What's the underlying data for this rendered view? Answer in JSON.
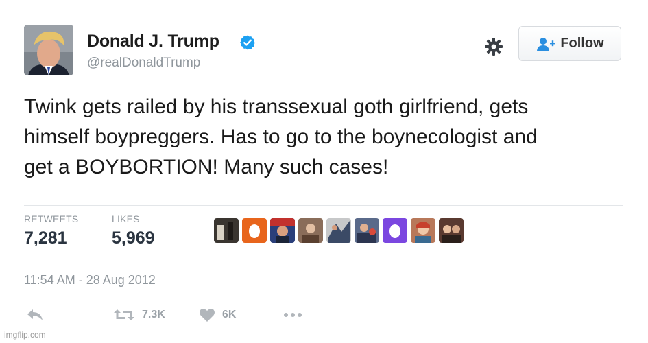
{
  "author": {
    "name": "Donald J. Trump",
    "handle": "@realDonaldTrump",
    "avatar_icon": "profile-photo",
    "verified_icon": "verified-badge-icon"
  },
  "header": {
    "settings_icon": "gear-icon",
    "follow_label": "Follow",
    "follow_icon": "add-user-icon"
  },
  "tweet": {
    "lines": [
      "Twink gets railed by his transsexual goth girlfriend, gets",
      "himself boypreggers. Has to go to the boynecologist and",
      "get a BOYBORTION! Many such cases!"
    ],
    "timestamp": "11:54 AM - 28 Aug 2012"
  },
  "stats": {
    "retweets_label": "RETWEETS",
    "retweets_value": "7,281",
    "likes_label": "LIKES",
    "likes_value": "5,969"
  },
  "likers_count": 9,
  "actions": {
    "reply_icon": "reply-icon",
    "retweet_icon": "retweet-icon",
    "retweet_count": "7.3K",
    "like_icon": "heart-icon",
    "like_count": "6K",
    "more_icon": "more-dots-icon"
  },
  "colors": {
    "verified_blue": "#1da1f2",
    "icon_gray": "#b1b6bb",
    "muted_text": "#8f969c",
    "liker_orange": "#e8651c",
    "liker_purple": "#7b47e0"
  },
  "watermark": "imgflip.com"
}
